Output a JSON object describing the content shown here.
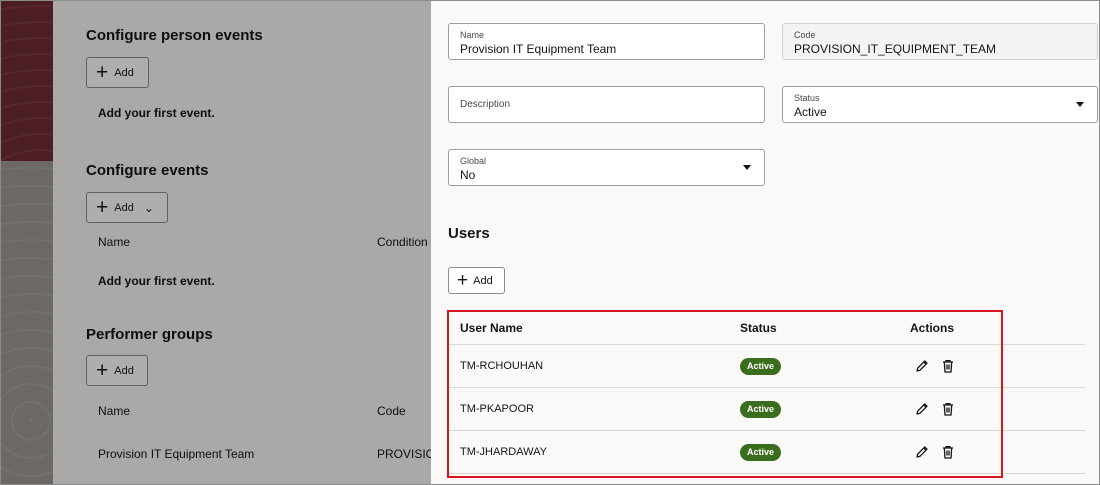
{
  "left": {
    "person_events": {
      "title": "Configure person events",
      "add_label": "Add",
      "empty": "Add your first event."
    },
    "events": {
      "title": "Configure events",
      "add_label": "Add",
      "col_name": "Name",
      "col_condition": "Condition",
      "empty": "Add your first event."
    },
    "performer_groups": {
      "title": "Performer groups",
      "add_label": "Add",
      "col_name": "Name",
      "col_code": "Code",
      "row_name": "Provision IT Equipment Team",
      "row_code": "PROVISION"
    }
  },
  "form": {
    "name": {
      "label": "Name",
      "value": "Provision IT Equipment Team"
    },
    "code": {
      "label": "Code",
      "value": "PROVISION_IT_EQUIPMENT_TEAM"
    },
    "description": {
      "label": "Description"
    },
    "status": {
      "label": "Status",
      "value": "Active"
    },
    "global": {
      "label": "Global",
      "value": "No"
    }
  },
  "users": {
    "title": "Users",
    "add_label": "Add",
    "columns": {
      "user_name": "User Name",
      "status": "Status",
      "actions": "Actions"
    },
    "rows": [
      {
        "user_name": "TM-RCHOUHAN",
        "status": "Active"
      },
      {
        "user_name": "TM-PKAPOOR",
        "status": "Active"
      },
      {
        "user_name": "TM-JHARDAWAY",
        "status": "Active"
      }
    ]
  },
  "colors": {
    "badge_active": "#3b6d1f",
    "highlight": "#d9161e",
    "backdrop": "#6e2a32"
  },
  "icons": {
    "edit": "pencil-icon",
    "delete": "trash-icon",
    "add": "plus-icon",
    "dropdown": "caret-down-icon"
  }
}
